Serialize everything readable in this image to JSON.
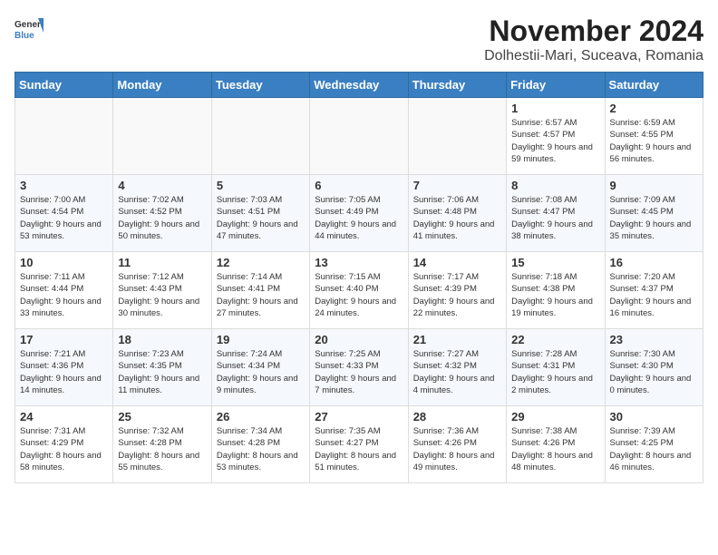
{
  "header": {
    "logo": {
      "line1": "General",
      "line2": "Blue"
    },
    "title": "November 2024",
    "subtitle": "Dolhestii-Mari, Suceava, Romania"
  },
  "days_of_week": [
    "Sunday",
    "Monday",
    "Tuesday",
    "Wednesday",
    "Thursday",
    "Friday",
    "Saturday"
  ],
  "weeks": [
    [
      {
        "day": "",
        "content": ""
      },
      {
        "day": "",
        "content": ""
      },
      {
        "day": "",
        "content": ""
      },
      {
        "day": "",
        "content": ""
      },
      {
        "day": "",
        "content": ""
      },
      {
        "day": "1",
        "content": "Sunrise: 6:57 AM\nSunset: 4:57 PM\nDaylight: 9 hours and 59 minutes."
      },
      {
        "day": "2",
        "content": "Sunrise: 6:59 AM\nSunset: 4:55 PM\nDaylight: 9 hours and 56 minutes."
      }
    ],
    [
      {
        "day": "3",
        "content": "Sunrise: 7:00 AM\nSunset: 4:54 PM\nDaylight: 9 hours and 53 minutes."
      },
      {
        "day": "4",
        "content": "Sunrise: 7:02 AM\nSunset: 4:52 PM\nDaylight: 9 hours and 50 minutes."
      },
      {
        "day": "5",
        "content": "Sunrise: 7:03 AM\nSunset: 4:51 PM\nDaylight: 9 hours and 47 minutes."
      },
      {
        "day": "6",
        "content": "Sunrise: 7:05 AM\nSunset: 4:49 PM\nDaylight: 9 hours and 44 minutes."
      },
      {
        "day": "7",
        "content": "Sunrise: 7:06 AM\nSunset: 4:48 PM\nDaylight: 9 hours and 41 minutes."
      },
      {
        "day": "8",
        "content": "Sunrise: 7:08 AM\nSunset: 4:47 PM\nDaylight: 9 hours and 38 minutes."
      },
      {
        "day": "9",
        "content": "Sunrise: 7:09 AM\nSunset: 4:45 PM\nDaylight: 9 hours and 35 minutes."
      }
    ],
    [
      {
        "day": "10",
        "content": "Sunrise: 7:11 AM\nSunset: 4:44 PM\nDaylight: 9 hours and 33 minutes."
      },
      {
        "day": "11",
        "content": "Sunrise: 7:12 AM\nSunset: 4:43 PM\nDaylight: 9 hours and 30 minutes."
      },
      {
        "day": "12",
        "content": "Sunrise: 7:14 AM\nSunset: 4:41 PM\nDaylight: 9 hours and 27 minutes."
      },
      {
        "day": "13",
        "content": "Sunrise: 7:15 AM\nSunset: 4:40 PM\nDaylight: 9 hours and 24 minutes."
      },
      {
        "day": "14",
        "content": "Sunrise: 7:17 AM\nSunset: 4:39 PM\nDaylight: 9 hours and 22 minutes."
      },
      {
        "day": "15",
        "content": "Sunrise: 7:18 AM\nSunset: 4:38 PM\nDaylight: 9 hours and 19 minutes."
      },
      {
        "day": "16",
        "content": "Sunrise: 7:20 AM\nSunset: 4:37 PM\nDaylight: 9 hours and 16 minutes."
      }
    ],
    [
      {
        "day": "17",
        "content": "Sunrise: 7:21 AM\nSunset: 4:36 PM\nDaylight: 9 hours and 14 minutes."
      },
      {
        "day": "18",
        "content": "Sunrise: 7:23 AM\nSunset: 4:35 PM\nDaylight: 9 hours and 11 minutes."
      },
      {
        "day": "19",
        "content": "Sunrise: 7:24 AM\nSunset: 4:34 PM\nDaylight: 9 hours and 9 minutes."
      },
      {
        "day": "20",
        "content": "Sunrise: 7:25 AM\nSunset: 4:33 PM\nDaylight: 9 hours and 7 minutes."
      },
      {
        "day": "21",
        "content": "Sunrise: 7:27 AM\nSunset: 4:32 PM\nDaylight: 9 hours and 4 minutes."
      },
      {
        "day": "22",
        "content": "Sunrise: 7:28 AM\nSunset: 4:31 PM\nDaylight: 9 hours and 2 minutes."
      },
      {
        "day": "23",
        "content": "Sunrise: 7:30 AM\nSunset: 4:30 PM\nDaylight: 9 hours and 0 minutes."
      }
    ],
    [
      {
        "day": "24",
        "content": "Sunrise: 7:31 AM\nSunset: 4:29 PM\nDaylight: 8 hours and 58 minutes."
      },
      {
        "day": "25",
        "content": "Sunrise: 7:32 AM\nSunset: 4:28 PM\nDaylight: 8 hours and 55 minutes."
      },
      {
        "day": "26",
        "content": "Sunrise: 7:34 AM\nSunset: 4:28 PM\nDaylight: 8 hours and 53 minutes."
      },
      {
        "day": "27",
        "content": "Sunrise: 7:35 AM\nSunset: 4:27 PM\nDaylight: 8 hours and 51 minutes."
      },
      {
        "day": "28",
        "content": "Sunrise: 7:36 AM\nSunset: 4:26 PM\nDaylight: 8 hours and 49 minutes."
      },
      {
        "day": "29",
        "content": "Sunrise: 7:38 AM\nSunset: 4:26 PM\nDaylight: 8 hours and 48 minutes."
      },
      {
        "day": "30",
        "content": "Sunrise: 7:39 AM\nSunset: 4:25 PM\nDaylight: 8 hours and 46 minutes."
      }
    ]
  ]
}
